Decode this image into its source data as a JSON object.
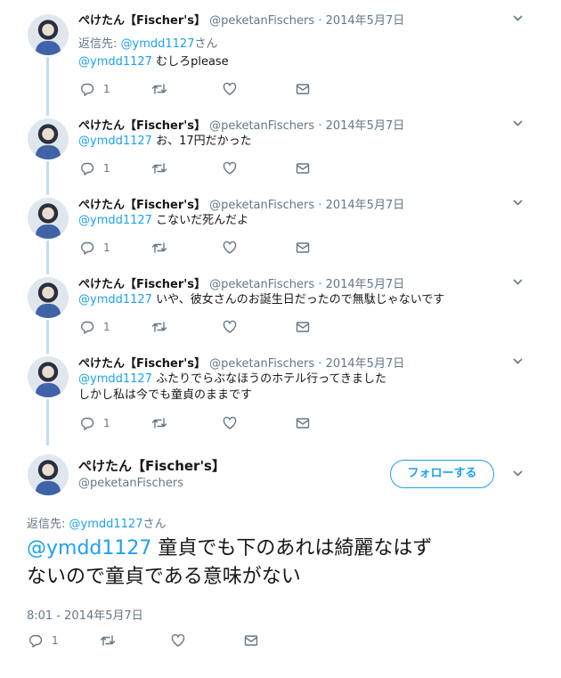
{
  "thread_tweets": [
    {
      "name": "ぺけたん【Fischer's】",
      "handle": "@peketanFischers",
      "date": "2014年5月7日",
      "reply_label": "返信先:",
      "reply_mention": "@ymdd1127",
      "reply_suffix": "さん",
      "mention": "@ymdd1127",
      "text_lines": [
        " むしろplease"
      ],
      "reply_count": "1"
    },
    {
      "name": "ぺけたん【Fischer's】",
      "handle": "@peketanFischers",
      "date": "2014年5月7日",
      "mention": "@ymdd1127",
      "text_lines": [
        " お、17円だかった"
      ],
      "reply_count": "1"
    },
    {
      "name": "ぺけたん【Fischer's】",
      "handle": "@peketanFischers",
      "date": "2014年5月7日",
      "mention": "@ymdd1127",
      "text_lines": [
        " こないだ死んだよ"
      ],
      "reply_count": "1"
    },
    {
      "name": "ぺけたん【Fischer's】",
      "handle": "@peketanFischers",
      "date": "2014年5月7日",
      "mention": "@ymdd1127",
      "text_lines": [
        " いや、彼女さんのお誕生日だったので無駄じゃないです"
      ],
      "reply_count": "1"
    },
    {
      "name": "ぺけたん【Fischer's】",
      "handle": "@peketanFischers",
      "date": "2014年5月7日",
      "mention": "@ymdd1127",
      "text_lines": [
        " ふたりでらぶなほうのホテル行ってきました",
        "しかし私は今でも童貞のままです"
      ],
      "reply_count": "1"
    }
  ],
  "separator": "·",
  "main_tweet": {
    "name": "ぺけたん【Fischer's】",
    "handle": "@peketanFischers",
    "follow_label": "フォローする",
    "reply_label": "返信先:",
    "reply_mention": "@ymdd1127",
    "reply_suffix": "さん",
    "mention": "@ymdd1127",
    "text_line1": " 童貞でも下のあれは綺麗なはず",
    "text_line2": "ないので童貞である意味がない",
    "timestamp": "8:01 - 2014年5月7日",
    "reply_count": "1"
  },
  "colors": {
    "accent": "#1da1f2",
    "thread_line": "#c4dcef",
    "secondary_text": "#657786"
  },
  "icons": [
    "reply-icon",
    "retweet-icon",
    "like-icon",
    "direct-message-icon",
    "chevron-down-icon"
  ]
}
